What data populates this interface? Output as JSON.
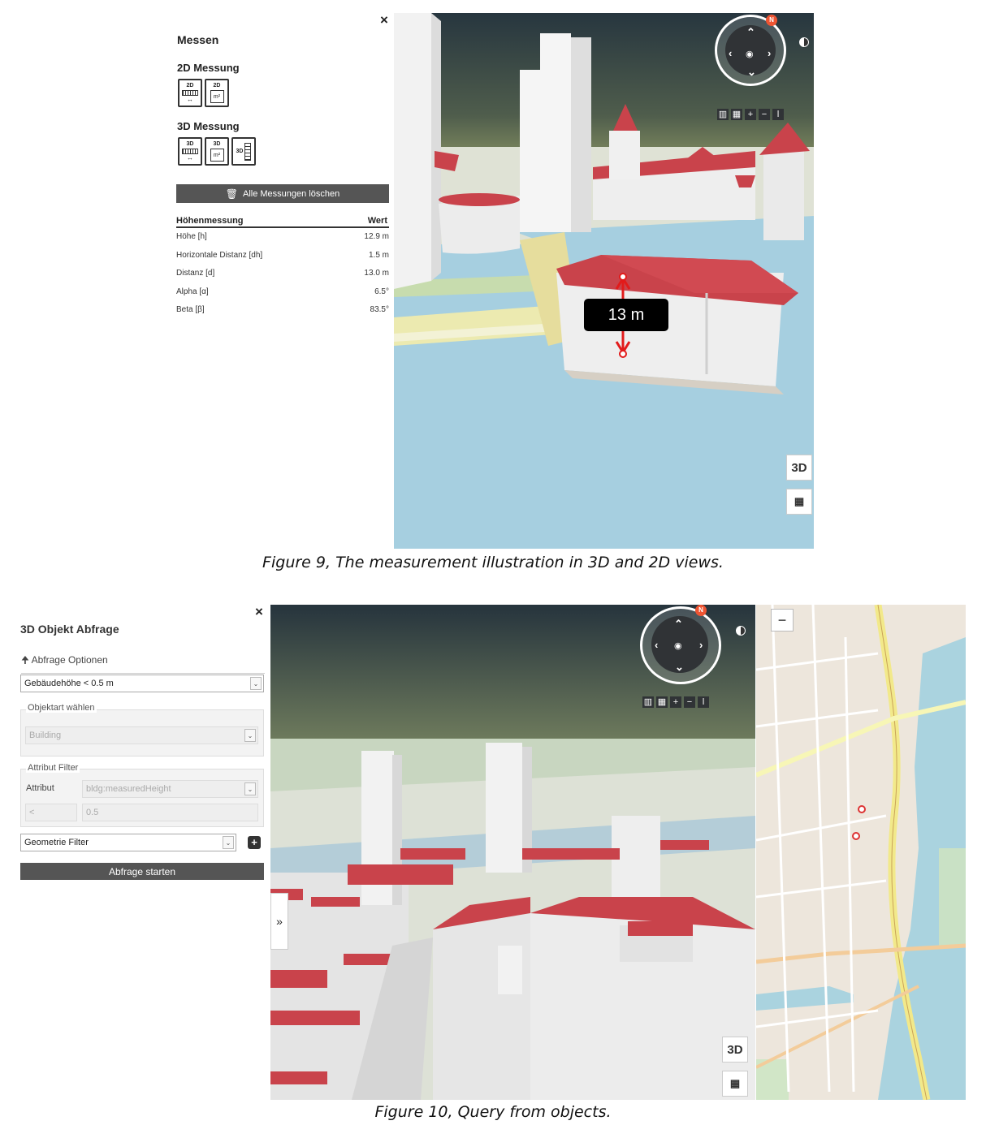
{
  "figure9": {
    "panel": {
      "close_icon": "×",
      "title": "Messen",
      "section_2d": "2D Messung",
      "section_3d": "3D Messung",
      "tools_2d": [
        {
          "icon": "2d-distance-icon",
          "tag": "2D"
        },
        {
          "icon": "2d-area-icon",
          "tag": "2D",
          "unit": "m²"
        }
      ],
      "tools_3d": [
        {
          "icon": "3d-distance-icon",
          "tag": "3D"
        },
        {
          "icon": "3d-area-icon",
          "tag": "3D",
          "unit": "m²"
        },
        {
          "icon": "3d-height-icon",
          "tag": "3D"
        }
      ],
      "delete_all_label": "Alle Messungen löschen",
      "table": {
        "header_name": "Höhenmessung",
        "header_value": "Wert",
        "rows": [
          {
            "name": "Höhe [h]",
            "value": "12.9 m"
          },
          {
            "name": "Horizontale Distanz [dh]",
            "value": "1.5 m"
          },
          {
            "name": "Distanz [d]",
            "value": "13.0 m"
          },
          {
            "name": "Alpha [α]",
            "value": "6.5°"
          },
          {
            "name": "Beta [β]",
            "value": "83.5°"
          }
        ]
      }
    },
    "view": {
      "measure_label": "13 m",
      "view_button": "3D",
      "colors": {
        "roof": "#c9434b",
        "water": "#a6cfe0",
        "sky_top": "#2f3d45",
        "sky_bottom": "#6e7a52",
        "building": "#eeeeee"
      }
    },
    "caption": "Figure 9, The measurement illustration in 3D and 2D views."
  },
  "figure10": {
    "panel": {
      "close_icon": "×",
      "title": "3D Objekt Abfrage",
      "options_toggle": "Abfrage Optionen",
      "preset_select": "Gebäudehöhe < 0.5 m",
      "object_type_legend": "Objektart wählen",
      "object_type_value": "Building",
      "attribute_filter_legend": "Attribut Filter",
      "attribute_label": "Attribut",
      "attribute_value": "bldg:measuredHeight",
      "operator_value": "<",
      "threshold_value": "0.5",
      "geometry_filter": "Geometrie Filter",
      "start_button": "Abfrage starten"
    },
    "view": {
      "view_button": "3D",
      "expand_icon": "»",
      "zoom_out_label": "−"
    },
    "caption": "Figure 10, Query from objects."
  }
}
